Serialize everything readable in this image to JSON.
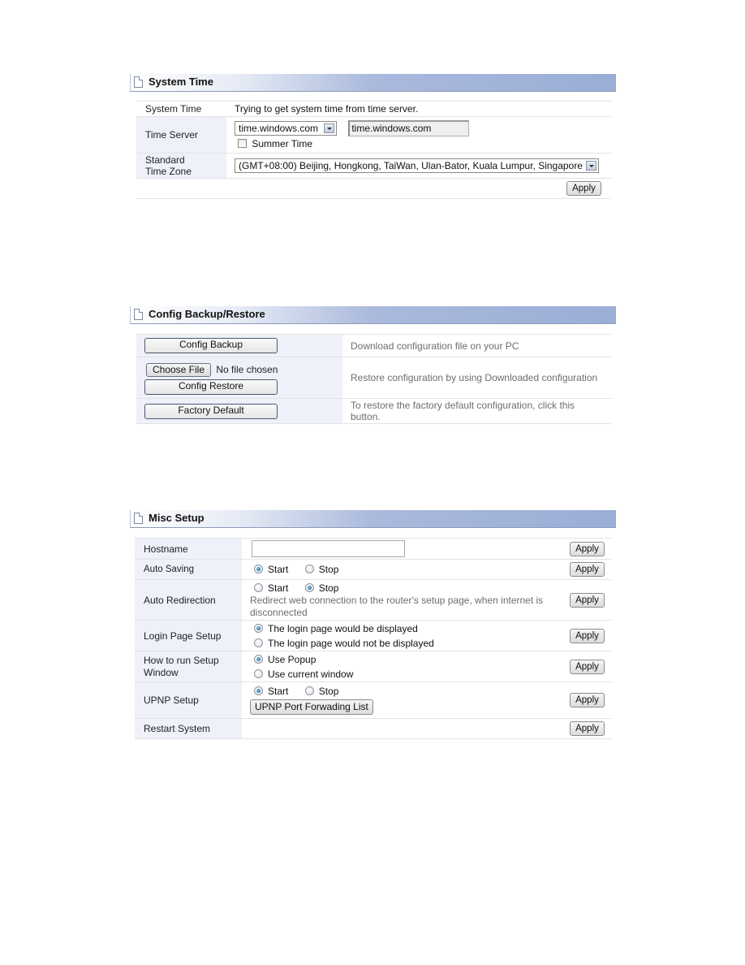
{
  "system_time": {
    "title": "System Time",
    "rows": {
      "system_time_label": "System Time",
      "system_time_value": "Trying to get system time from time server.",
      "time_server_label": "Time Server",
      "time_server_select": "time.windows.com",
      "time_server_input": "time.windows.com",
      "summer_time_label": "Summer Time",
      "summer_time_checked": false,
      "time_zone_label_line1": "Standard",
      "time_zone_label_line2": "Time Zone",
      "time_zone_select": "(GMT+08:00) Beijing, Hongkong, TaiWan, Ulan-Bator, Kuala Lumpur, Singapore"
    },
    "apply_label": "Apply"
  },
  "config": {
    "title": "Config Backup/Restore",
    "backup_button": "Config Backup",
    "backup_desc": "Download configuration file on your PC",
    "choose_file_button": "Choose File",
    "no_file_text": "No file chosen",
    "restore_button": "Config Restore",
    "restore_desc": "Restore configuration by using Downloaded configuration",
    "factory_button": "Factory Default",
    "factory_desc": "To restore the factory default configuration, click this button."
  },
  "misc": {
    "title": "Misc Setup",
    "apply_label": "Apply",
    "hostname": {
      "label": "Hostname",
      "value": ""
    },
    "auto_saving": {
      "label": "Auto Saving",
      "options": [
        "Start",
        "Stop"
      ],
      "selected": "Start"
    },
    "auto_redirection": {
      "label": "Auto Redirection",
      "options": [
        "Start",
        "Stop"
      ],
      "selected": "Stop",
      "desc_line1": " Redirect web connection to the router's setup page, when internet is",
      "desc_line2": "disconnected"
    },
    "login_page": {
      "label": "Login Page Setup",
      "options": [
        "The login page would be displayed",
        "The login page would not be displayed"
      ],
      "selected": "The login page would be displayed"
    },
    "setup_window": {
      "label_line1": "How to run Setup",
      "label_line2": "Window",
      "options": [
        "Use Popup",
        "Use current window"
      ],
      "selected": "Use Popup"
    },
    "upnp": {
      "label": "UPNP Setup",
      "options": [
        "Start",
        "Stop"
      ],
      "selected": "Start",
      "list_button": "UPNP Port Forwading List"
    },
    "restart": {
      "label": "Restart System"
    }
  }
}
